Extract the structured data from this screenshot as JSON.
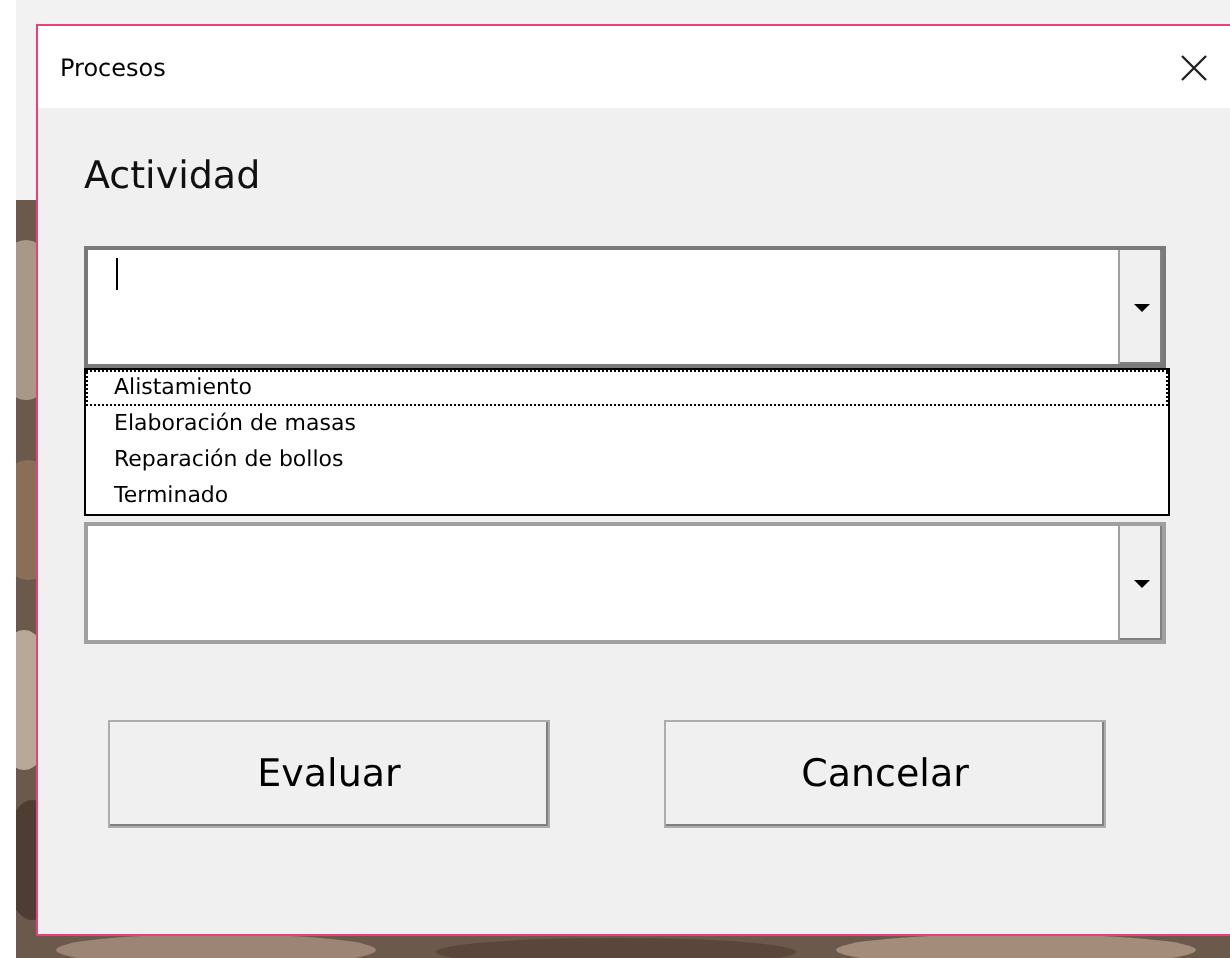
{
  "window": {
    "title": "Procesos"
  },
  "label": "Actividad",
  "combos": [
    {
      "focused": true,
      "options": [
        {
          "label": "Alistamiento",
          "selected": true
        },
        {
          "label": "Elaboración de masas",
          "selected": false
        },
        {
          "label": "Reparación de bollos",
          "selected": false
        },
        {
          "label": "Terminado",
          "selected": false
        }
      ]
    },
    {
      "focused": false
    }
  ],
  "buttons": [
    "Evaluar",
    "Cancelar"
  ]
}
